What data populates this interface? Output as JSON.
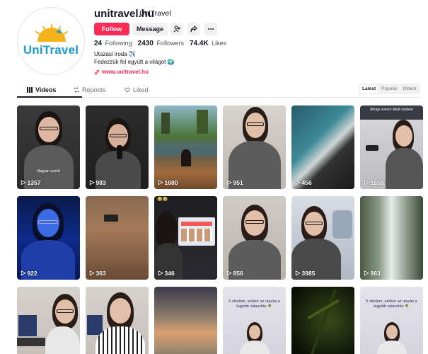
{
  "profile": {
    "username": "unitravel.hu",
    "nickname": "UniTravel",
    "avatar_text": "UniTravel",
    "follow_label": "Follow",
    "message_label": "Message",
    "stats": {
      "following_count": "24",
      "following_label": "Following",
      "followers_count": "2430",
      "followers_label": "Followers",
      "likes_count": "74.4K",
      "likes_label": "Likes"
    },
    "bio_line1": "Utazási iroda ✈️",
    "bio_line2": "Fedezzük fel együtt a világot 🌍",
    "link": "www.unitravel.hu"
  },
  "tabs": {
    "videos": "Videos",
    "reposts": "Reposts",
    "liked": "Liked"
  },
  "sort": {
    "latest": "Latest",
    "popular": "Popular",
    "oldest": "Oldest"
  },
  "videos": [
    {
      "views": "1357",
      "caption": "Magyar nyelvű",
      "overlay": ""
    },
    {
      "views": "983",
      "caption": "",
      "overlay": ""
    },
    {
      "views": "1680",
      "caption": "",
      "overlay": ""
    },
    {
      "views": "951",
      "caption": "",
      "overlay": ""
    },
    {
      "views": "456",
      "caption": "",
      "overlay": ""
    },
    {
      "views": "1658",
      "caption": "",
      "overlay": "Ahogy sosem látott vizeken"
    },
    {
      "views": "922",
      "caption": "",
      "overlay": ""
    },
    {
      "views": "363",
      "caption": "",
      "overlay": ""
    },
    {
      "views": "346",
      "caption": "",
      "overlay": "😂😂"
    },
    {
      "views": "856",
      "caption": "",
      "overlay": ""
    },
    {
      "views": "3985",
      "caption": "",
      "overlay": ""
    },
    {
      "views": "883",
      "caption": "",
      "overlay": ""
    },
    {
      "views": "",
      "caption": "",
      "overlay": ""
    },
    {
      "views": "",
      "caption": "",
      "overlay": ""
    },
    {
      "views": "",
      "caption": "",
      "overlay": ""
    },
    {
      "views": "",
      "caption": "",
      "overlay": "5 zikolom, amikor az utazás a legjobb választás 🌴"
    },
    {
      "views": "",
      "caption": "",
      "overlay": ""
    },
    {
      "views": "",
      "caption": "",
      "overlay": "5 zikolom, amikor az utazás a legjobb választás 🌴"
    }
  ],
  "colors": {
    "accent": "#fe2c55",
    "text": "#161823",
    "secondary": "#73757a"
  }
}
